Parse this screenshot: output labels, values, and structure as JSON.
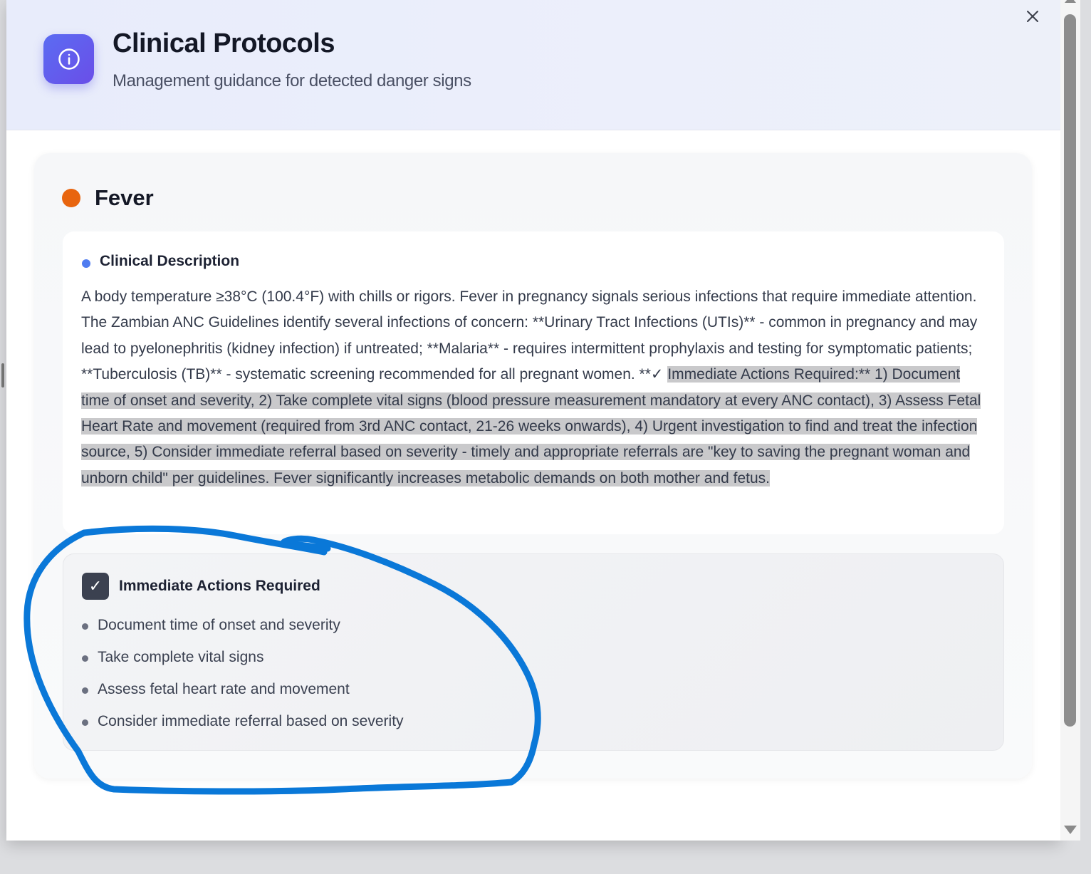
{
  "header": {
    "title": "Clinical Protocols",
    "subtitle": "Management guidance for detected danger signs",
    "info_icon": "info-circle-icon",
    "close_icon": "close-icon"
  },
  "danger_sign": {
    "name": "Fever",
    "indicator_color": "#e8650f",
    "description_label": "Clinical Description",
    "description_normal": "A body temperature ≥38°C (100.4°F) with chills or rigors. Fever in pregnancy signals serious infections that require immediate attention. The Zambian ANC Guidelines identify several infections of concern: **Urinary Tract Infections (UTIs)** - common in pregnancy and may lead to pyelonephritis (kidney infection) if untreated; **Malaria** - requires intermittent prophylaxis and testing for symptomatic patients; **Tuberculosis (TB)** - systematic screening recommended for all pregnant women. **✓ ",
    "description_selected": "Immediate Actions Required:** 1) Document time of onset and severity, 2) Take complete vital signs (blood pressure measurement mandatory at every ANC contact), 3) Assess Fetal Heart Rate and movement (required from 3rd ANC contact, 21-26 weeks onwards), 4) Urgent investigation to find and treat the infection source, 5) Consider immediate referral based on severity - timely and appropriate referrals are \"key to saving the pregnant woman and unborn child\" per guidelines. Fever significantly increases metabolic demands on both mother and fetus.",
    "actions_title": "Immediate Actions Required",
    "actions_check": "✓",
    "actions": [
      "Document time of onset and severity",
      "Take complete vital signs",
      "Assess fetal heart rate and movement",
      "Consider immediate referral based on severity"
    ]
  },
  "colors": {
    "accent": "#5b6cf2",
    "annotation": "#0a78d8",
    "selection": "#c9c9cb"
  }
}
